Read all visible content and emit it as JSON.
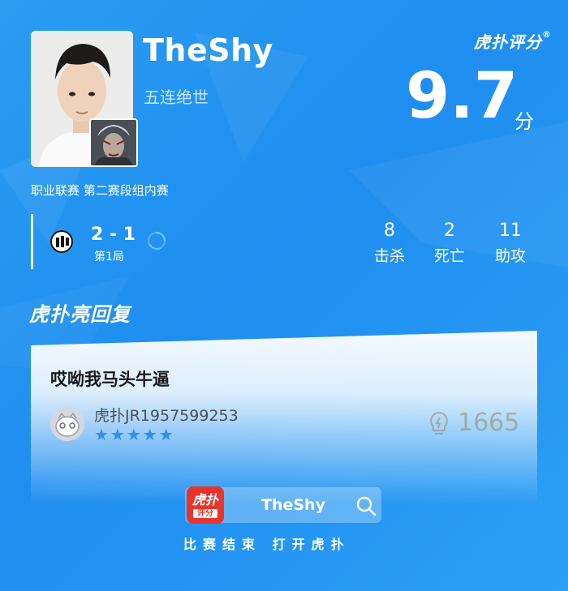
{
  "player": {
    "name": "TheShy",
    "title": "五连绝世"
  },
  "brand": {
    "logo_text": "虎扑评分",
    "registered": "®",
    "section_logo": "虎扑亮回复"
  },
  "rating": {
    "score": "9.7",
    "unit": "分"
  },
  "match": {
    "event": "职业联赛 第二赛段组内赛",
    "series_score": "2 - 1",
    "round": "第1局"
  },
  "stats": [
    {
      "value": "8",
      "label": "击杀"
    },
    {
      "value": "2",
      "label": "死亡"
    },
    {
      "value": "11",
      "label": "助攻"
    }
  ],
  "reply": {
    "text": "哎呦我马头牛逼",
    "username": "虎扑JR1957599253",
    "stars": "★★★★★",
    "star_rating": 5,
    "likes": "1665"
  },
  "footer": {
    "search_text": "TheShy",
    "app_icon_line1": "虎扑",
    "app_icon_line2": "评分",
    "cta": "比赛结束 打开虎扑"
  },
  "colors": {
    "background": "#2196f3",
    "accent_blue": "#2f8df0",
    "app_red": "#e8352c"
  }
}
